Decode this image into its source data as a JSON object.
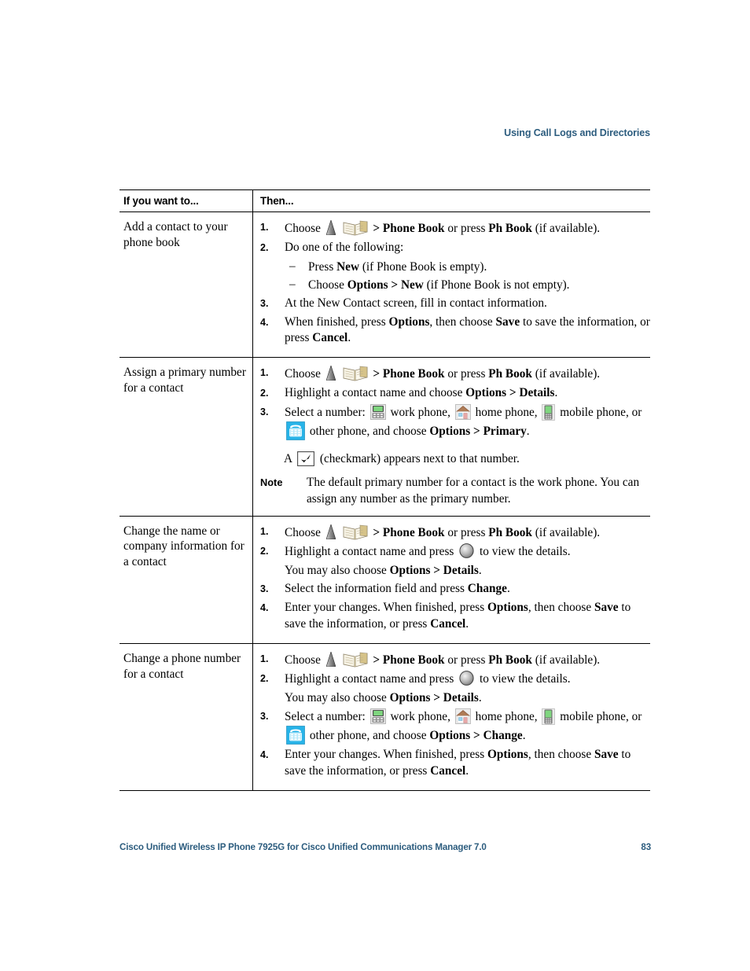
{
  "running_head": "Using Call Logs and Directories",
  "table": {
    "headers": [
      "If you want to...",
      "Then..."
    ],
    "rows": [
      {
        "want": "Add a contact to your phone book",
        "steps": [
          {
            "num": "1.",
            "pre": "Choose",
            "icons": [
              "nav-arrow-icon",
              "phone-book-icon"
            ],
            "post_bold": "> Phone Book",
            "post": " or press ",
            "post_bold2": "Ph Book",
            "post2": " (if available)."
          },
          {
            "num": "2.",
            "text": "Do one of the following:",
            "subitems": [
              {
                "dash": "–",
                "pre": "Press ",
                "bold": "New",
                "post": " (if Phone Book is empty)."
              },
              {
                "dash": "–",
                "pre": "Choose ",
                "bold": "Options > New",
                "post": " (if Phone Book is not empty)."
              }
            ]
          },
          {
            "num": "3.",
            "text": "At the New Contact screen, fill in contact information."
          },
          {
            "num": "4.",
            "pre": "When finished, press ",
            "bold": "Options",
            "mid": ", then choose ",
            "bold2": "Save",
            "mid2": " to save the information, or press ",
            "bold3": "Cancel",
            "post": "."
          }
        ]
      },
      {
        "want": "Assign a primary number for a contact",
        "steps": [
          {
            "num": "1.",
            "pre": "Choose",
            "post_bold": "> Phone Book",
            "post": " or press ",
            "post_bold2": "Ph Book",
            "post2": " (if available)."
          },
          {
            "num": "2.",
            "pre": "Highlight a contact name and choose ",
            "bold": "Options > Details",
            "post": "."
          },
          {
            "num": "3.",
            "select_label": "Select a number:",
            "work_label": "work phone,",
            "home_label": "home phone,",
            "mobile_label": "mobile phone, or",
            "other_label": "other phone, and choose",
            "action_bold": "Options > Primary",
            "action_post": "."
          }
        ],
        "checkmark_line": {
          "a": "A",
          "b": "(checkmark) appears next to that number."
        },
        "note": {
          "label": "Note",
          "text": "The default primary number for a contact is the work phone. You can assign any number as the primary number."
        }
      },
      {
        "want": "Change the name or company information for a contact",
        "steps": [
          {
            "num": "1.",
            "pre": "Choose",
            "post_bold": "> Phone Book",
            "post": " or press ",
            "post_bold2": "Ph Book",
            "post2": " (if available)."
          },
          {
            "num": "2.",
            "pre": "Highlight a contact name and press",
            "post": "to view the details.",
            "cont_pre": "You may also choose ",
            "cont_bold": "Options > Details",
            "cont_post": "."
          },
          {
            "num": "3.",
            "pre": "Select the information field and press ",
            "bold": "Change",
            "post": "."
          },
          {
            "num": "4.",
            "pre": "Enter your changes. When finished, press ",
            "bold": "Options",
            "mid": ", then choose ",
            "bold2": "Save",
            "mid2": " to save the information, or press ",
            "bold3": "Cancel",
            "post": "."
          }
        ]
      },
      {
        "want": "Change a phone number for a contact",
        "steps": [
          {
            "num": "1.",
            "pre": "Choose",
            "post_bold": "> Phone Book",
            "post": " or press ",
            "post_bold2": "Ph Book",
            "post2": " (if available)."
          },
          {
            "num": "2.",
            "pre": "Highlight a contact name and press",
            "post": "to view the details.",
            "cont_pre": "You may also choose ",
            "cont_bold": "Options > Details",
            "cont_post": "."
          },
          {
            "num": "3.",
            "select_label": "Select a number:",
            "work_label": "work phone,",
            "home_label": "home phone,",
            "mobile_label": "mobile phone, or",
            "other_label": "other phone, and choose",
            "action_bold": "Options > Change",
            "action_post": "."
          },
          {
            "num": "4.",
            "pre": "Enter your changes. When finished, press ",
            "bold": "Options",
            "mid": ", then choose ",
            "bold2": "Save",
            "mid2": " to save the information, or press ",
            "bold3": "Cancel",
            "post": "."
          }
        ]
      }
    ]
  },
  "footer": {
    "title": "Cisco Unified Wireless IP Phone 7925G for Cisco Unified Communications Manager 7.0",
    "page_number": "83"
  },
  "colors": {
    "accent": "#2c5c7e",
    "rule": "#000000"
  }
}
